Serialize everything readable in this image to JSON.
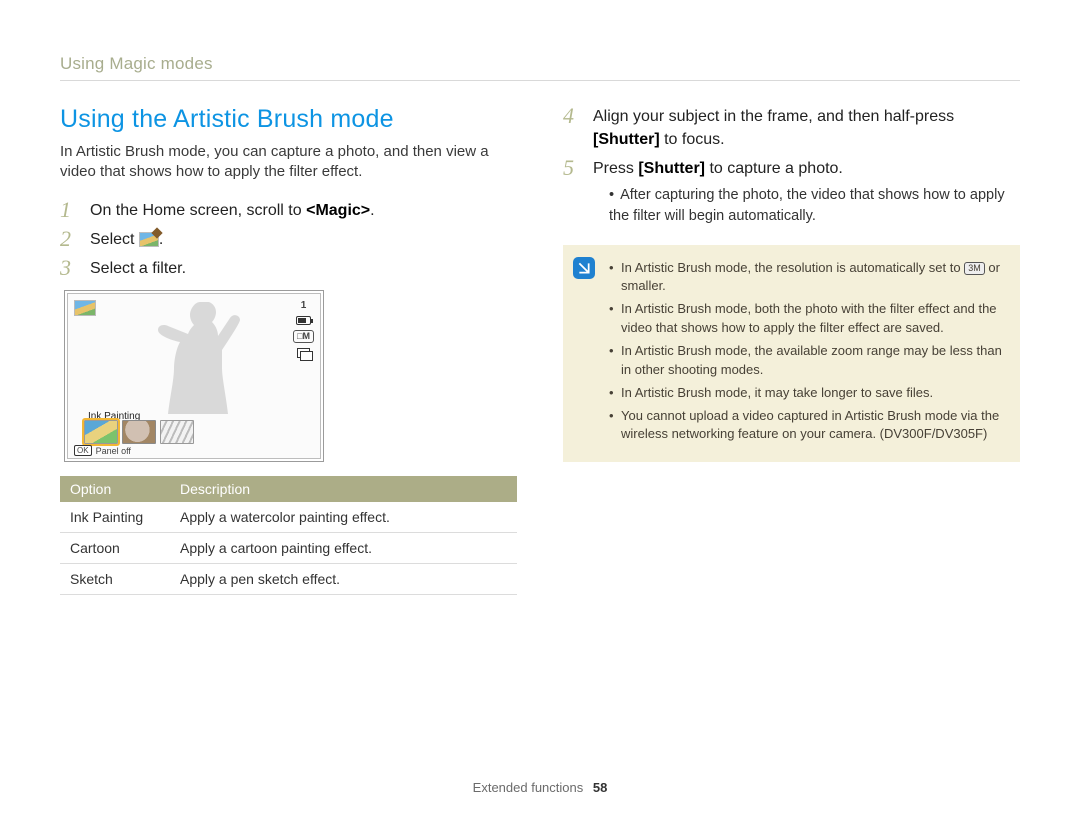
{
  "breadcrumb": "Using Magic modes",
  "section_title": "Using the Artistic Brush mode",
  "intro": "In Artistic Brush mode, you can capture a photo, and then view a video that shows how to apply the filter effect.",
  "steps_left": {
    "s1": {
      "num": "1",
      "text_before": "On the Home screen, scroll to ",
      "bold": "<Magic>",
      "text_after": "."
    },
    "s2": {
      "num": "2",
      "text_before": "Select ",
      "text_after": "."
    },
    "s3": {
      "num": "3",
      "text": "Select a filter."
    }
  },
  "screen": {
    "count": "1",
    "filter_label": "Ink Painting",
    "panel_off_btn": "OK",
    "panel_off_label": "Panel off"
  },
  "table": {
    "head_option": "Option",
    "head_desc": "Description",
    "rows": [
      {
        "option": "Ink Painting",
        "desc": "Apply a watercolor painting effect."
      },
      {
        "option": "Cartoon",
        "desc": "Apply a cartoon painting effect."
      },
      {
        "option": "Sketch",
        "desc": "Apply a pen sketch effect."
      }
    ]
  },
  "steps_right": {
    "s4": {
      "num": "4",
      "text_before": "Align your subject in the frame, and then half-press ",
      "bold": "[Shutter]",
      "text_after": " to focus."
    },
    "s5": {
      "num": "5",
      "text_before": "Press ",
      "bold": "[Shutter]",
      "text_after": " to capture a photo."
    },
    "s5_note": "After capturing the photo, the video that shows how to apply the filter will begin automatically."
  },
  "info": {
    "items": {
      "i1_before": "In Artistic Brush mode, the resolution is automatically set to ",
      "i1_pill": "3M",
      "i1_after": " or smaller.",
      "i2": "In Artistic Brush mode, both the photo with the filter effect and the video that shows how to apply the filter effect are saved.",
      "i3": "In Artistic Brush mode, the available zoom range may be less than in other shooting modes.",
      "i4": "In Artistic Brush mode, it may take longer to save files.",
      "i5": "You cannot upload a video captured in Artistic Brush mode via the wireless networking feature on your camera. (DV300F/DV305F)"
    }
  },
  "footer": {
    "section": "Extended functions",
    "page": "58"
  }
}
